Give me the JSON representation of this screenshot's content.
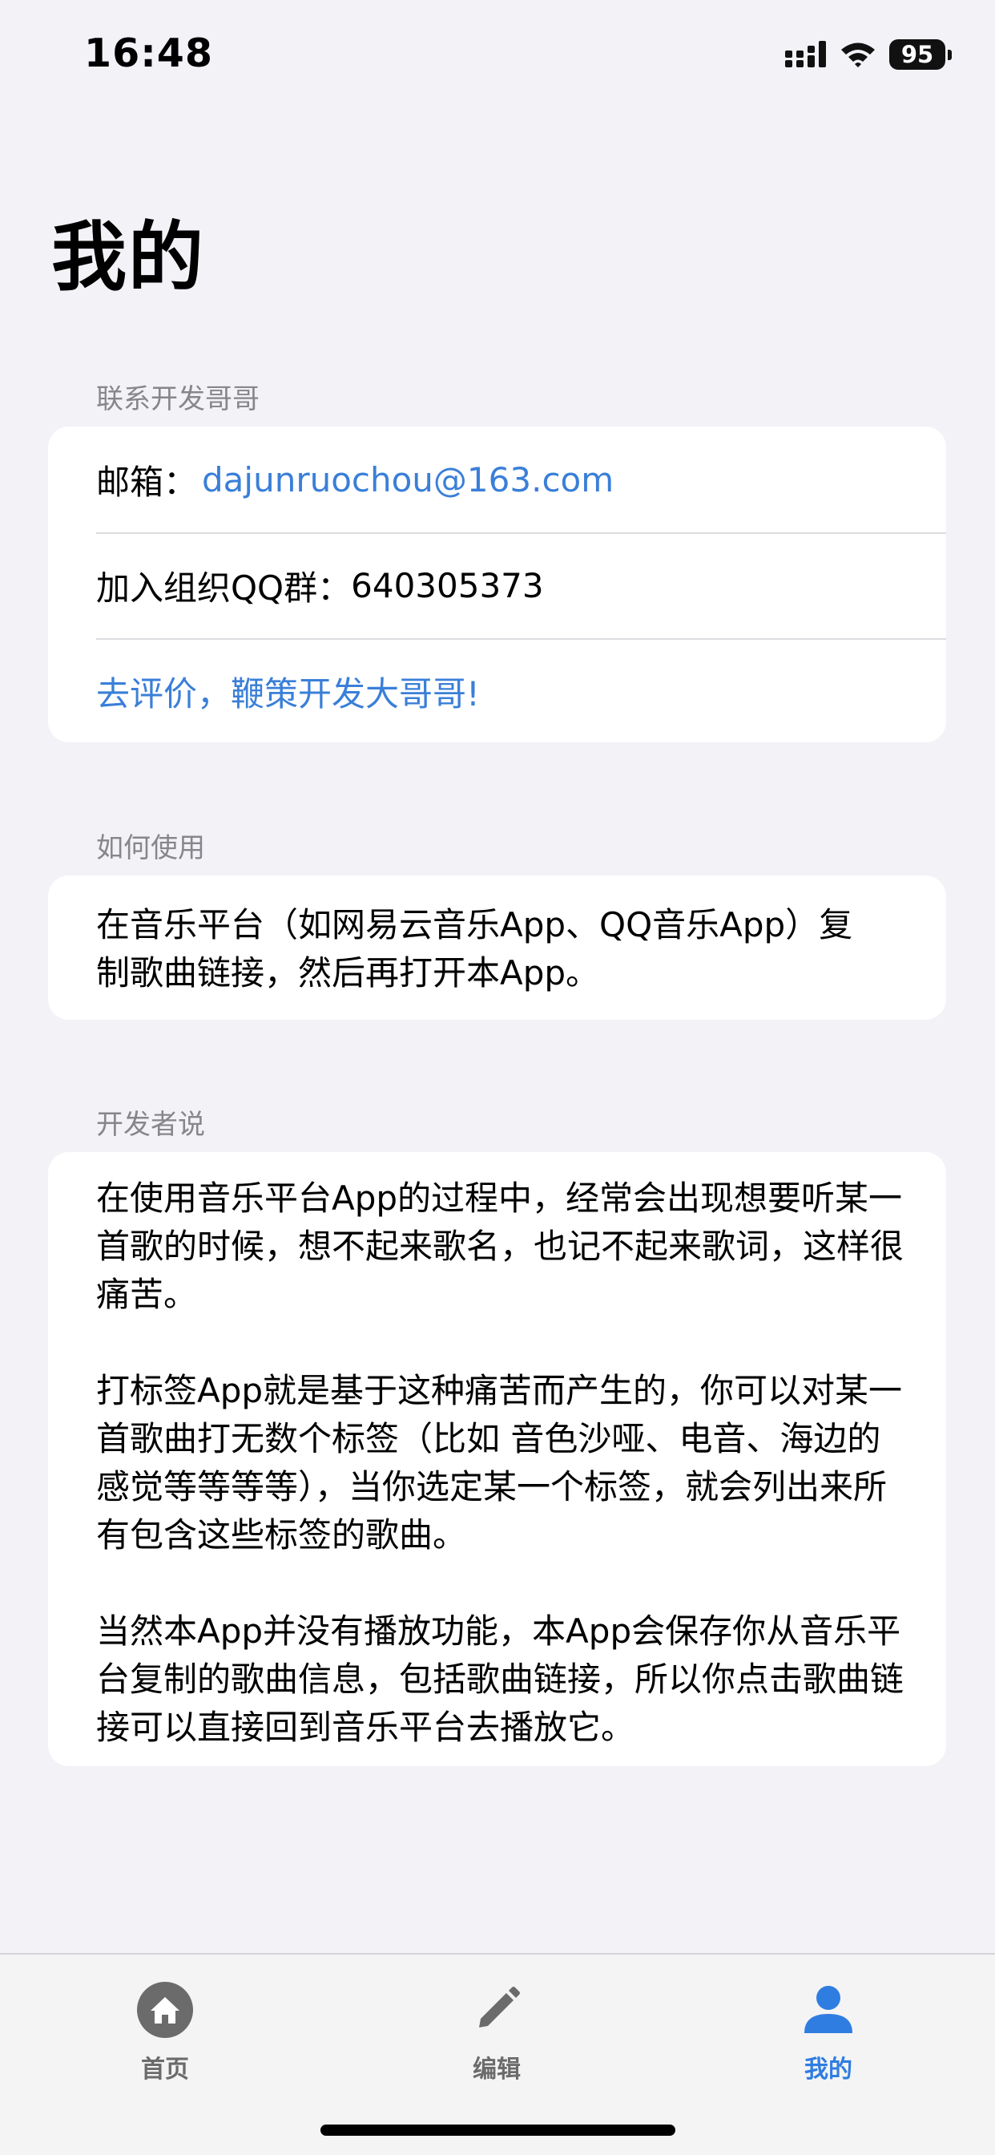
{
  "status_bar": {
    "time": "16:48",
    "battery": "95",
    "icons": [
      "signal-icon",
      "wifi-icon",
      "battery-icon"
    ]
  },
  "page": {
    "title": "我的"
  },
  "contact": {
    "header": "联系开发哥哥",
    "email_label": "邮箱：",
    "email_value": "dajunruochou@163.com",
    "qq_label": "加入组织QQ群：",
    "qq_value": "640305373",
    "review_link": "去评价，鞭策开发大哥哥!"
  },
  "usage": {
    "header": "如何使用",
    "text": "在音乐平台（如网易云音乐App、QQ音乐App）复制歌曲链接，然后再打开本App。"
  },
  "developer": {
    "header": "开发者说",
    "paragraphs": [
      "在使用音乐平台App的过程中，经常会出现想要听某一首歌的时候，想不起来歌名，也记不起来歌词，这样很痛苦。",
      "打标签App就是基于这种痛苦而产生的，你可以对某一首歌曲打无数个标签（比如 音色沙哑、电音、海边的感觉等等等等），当你选定某一个标签，就会列出来所有包含这些标签的歌曲。",
      "当然本App并没有播放功能，本App会保存你从音乐平台复制的歌曲信息，包括歌曲链接，所以你点击歌曲链接可以直接回到音乐平台去播放它。"
    ]
  },
  "tab_bar": {
    "tabs": [
      {
        "label": "首页",
        "icon": "home-icon",
        "active": false
      },
      {
        "label": "编辑",
        "icon": "pencil-icon",
        "active": false
      },
      {
        "label": "我的",
        "icon": "person-icon",
        "active": true
      }
    ]
  },
  "colors": {
    "accent": "#2f7de1",
    "link": "#3a7fd8",
    "background": "#f2f2f7",
    "card": "#ffffff",
    "secondary_text": "#86868b"
  }
}
